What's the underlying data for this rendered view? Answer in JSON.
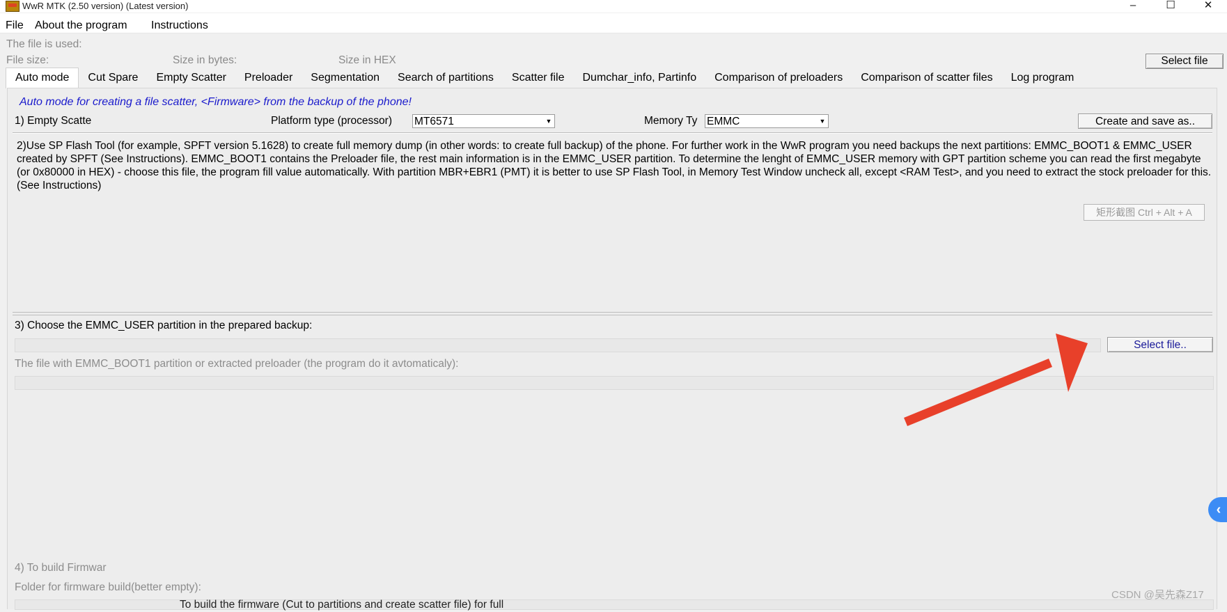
{
  "window": {
    "title": "WwR MTK (2.50 version) (Latest version)",
    "minimize": "–",
    "maximize": "☐",
    "close": "✕"
  },
  "menu": {
    "items": [
      "File",
      "About the program",
      "Instructions"
    ]
  },
  "file_info": {
    "file_used_label": "The file is used:",
    "file_size_label": "File size:",
    "size_bytes_label": "Size in bytes:",
    "size_hex_label": "Size in HEX",
    "select_file_label": "Select file"
  },
  "tabs": [
    {
      "label": "Auto mode",
      "active": true
    },
    {
      "label": "Cut Spare",
      "active": false
    },
    {
      "label": "Empty Scatter",
      "active": false
    },
    {
      "label": "Preloader",
      "active": false
    },
    {
      "label": "Segmentation",
      "active": false
    },
    {
      "label": "Search of partitions",
      "active": false
    },
    {
      "label": "Scatter file",
      "active": false
    },
    {
      "label": "Dumchar_info, Partinfo",
      "active": false
    },
    {
      "label": "Comparison of preloaders",
      "active": false
    },
    {
      "label": "Comparison of scatter files",
      "active": false
    },
    {
      "label": "Log program",
      "active": false
    }
  ],
  "auto_mode": {
    "heading": "Auto mode for creating a file scatter, <Firmware> from the backup of the phone!",
    "step1": {
      "label": "1) Empty Scatte",
      "platform_label": "Platform type (processor)",
      "platform_value": "MT6571",
      "memory_label": "Memory Ty",
      "memory_value": "EMMC",
      "create_button": "Create and save as.."
    },
    "step2_text": "2)Use SP Flash Tool (for example, SPFT version 5.1628) to create full memory dump (in other words: to create full backup) of the phone. For further work in the WwR program you need backups the next partitions: EMMC_BOOT1 & EMMC_USER created by SPFT (See Instructions). EMMC_BOOT1 contains the Preloader file, the rest main information is in the EMMC_USER partition. To determine the lenght of EMMC_USER memory with GPT partition scheme you can read the first megabyte (or 0x80000 in HEX) - choose this file, the program fill value automatically. With partition MBR+EBR1 (PMT) it is better to use SP Flash Tool, in Memory Test Window uncheck all, except <RAM Test>, and you need to extract the stock preloader for this. (See Instructions)",
    "screenshot_hint": "矩形截图 Ctrl + Alt + A",
    "step3": {
      "label": "3) Choose the EMMC_USER partition in the prepared backup:",
      "select_button": "Select file..",
      "boot1_label": "The file with EMMC_BOOT1 partition or extracted preloader (the program do it avtomaticaly):"
    },
    "step4": {
      "label": "4) To build Firmwar",
      "folder_label": "Folder for firmware build(better empty):",
      "build_button": "To build the firmware (Cut to partitions and create scatter file) for full"
    }
  },
  "overlay": {
    "collapse_icon": "‹",
    "watermark": "CSDN @吴先森Z17",
    "arrow_color": "#e8402a"
  }
}
